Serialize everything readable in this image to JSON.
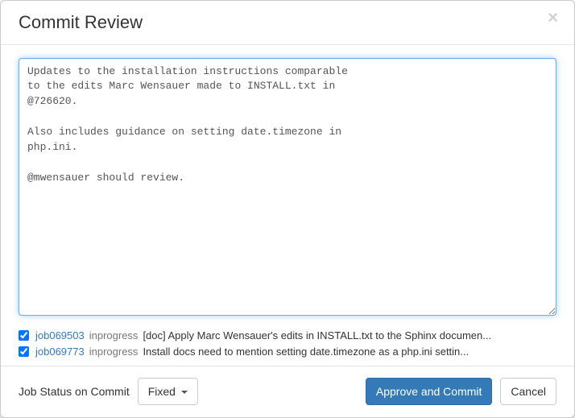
{
  "header": {
    "title": "Commit Review",
    "close_label": "×"
  },
  "body": {
    "commit_message": "Updates to the installation instructions comparable\nto the edits Marc Wensauer made to INSTALL.txt in\n@726620.\n\nAlso includes guidance on setting date.timezone in\nphp.ini.\n\n@mwensauer should review."
  },
  "jobs": [
    {
      "checked": true,
      "id": "job069503",
      "status": "inprogress",
      "description": "[doc] Apply Marc Wensauer's edits in INSTALL.txt to the Sphinx documen..."
    },
    {
      "checked": true,
      "id": "job069773",
      "status": "inprogress",
      "description": "Install docs need to mention setting date.timezone as a php.ini settin..."
    }
  ],
  "footer": {
    "status_label": "Job Status on Commit",
    "status_dropdown_value": "Fixed",
    "approve_label": "Approve and Commit",
    "cancel_label": "Cancel"
  }
}
